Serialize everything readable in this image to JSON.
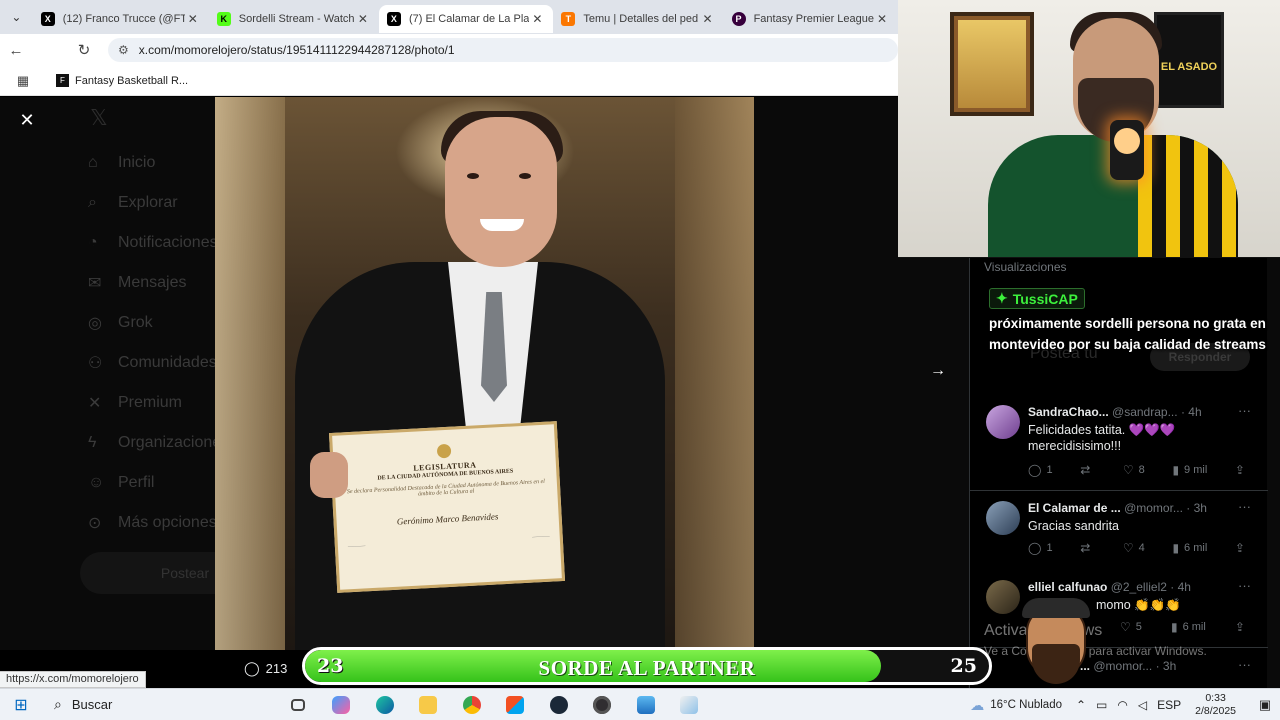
{
  "browser": {
    "tabs": [
      {
        "title": "(12) Franco Trucce (@FT",
        "favicon": "X",
        "active": false
      },
      {
        "title": "Sordelli Stream - Watch",
        "favicon": "K",
        "active": false
      },
      {
        "title": "(7) El Calamar de La Pla",
        "favicon": "X",
        "active": true
      },
      {
        "title": "Temu | Detalles del ped",
        "favicon": "T",
        "active": false
      },
      {
        "title": "Fantasy Premier League",
        "favicon": "P",
        "active": false
      }
    ],
    "url": "x.com/momorelojero/status/1951411122944287128/photo/1",
    "bookmark": "Fantasy Basketball R..."
  },
  "sidebar_dim": {
    "items": [
      "Inicio",
      "Explorar",
      "Notificaciones",
      "Mensajes",
      "Grok",
      "Comunidades",
      "Premium",
      "Organizaciones",
      "Perfil",
      "Más opciones"
    ],
    "post_button": "Postear"
  },
  "photo": {
    "certificate": {
      "line1": "LEGISLATURA",
      "line2": "DE LA CIUDAD AUTÓNOMA DE BUENOS AIRES",
      "line3": "Se declara Personalidad Destacada de la Ciudad Autónoma de Buenos Aires en el ámbito de la Cultura al",
      "name": "Gerónimo Marco Benavides"
    }
  },
  "bottombar": {
    "replies": "213"
  },
  "thread": {
    "views_label": "Visualizaciones",
    "reply_placeholder": "Postea tu",
    "reply_button": "Responder",
    "tweets": [
      {
        "name": "SandraChao...",
        "handle": "@sandrap...",
        "time": "· 4h",
        "text": "Felicidades tatita. 💜💜💜 merecidisisimo!!!",
        "replies": "1",
        "likes": "8",
        "views": "9 mil"
      },
      {
        "name": "El Calamar de ...",
        "handle": "@momor...",
        "time": "· 3h",
        "text": "Gracias sandrita",
        "replies": "1",
        "likes": "4",
        "views": "6 mil"
      },
      {
        "name": "elliel calfunao",
        "handle": "@2_elliel2",
        "time": "· 4h",
        "text": "momo 👏👏👏",
        "replies": "",
        "likes": "5",
        "views": "6 mil"
      },
      {
        "name": "...",
        "handle": "@momor...",
        "time": "· 3h",
        "text": "",
        "replies": "",
        "likes": "",
        "views": ""
      }
    ]
  },
  "stream_overlay": {
    "chat_user": "TussiCAP",
    "chat_message": "próximamente sordelli persona no grata en montevideo por su baja calidad de streams",
    "goal": {
      "current": 23,
      "label": "SORDE AL PARTNER",
      "target": 25
    },
    "webcam_poster": "EL ASADO",
    "windows_activation": {
      "title": "Activar Windows",
      "subtitle": "Ve a Configuración para activar Windows."
    }
  },
  "status_url": "https://x.com/momorelojero",
  "taskbar": {
    "search": "Buscar",
    "weather": "16°C  Nublado",
    "lang": "ESP",
    "time": "0:33",
    "date": "2/8/2025"
  }
}
